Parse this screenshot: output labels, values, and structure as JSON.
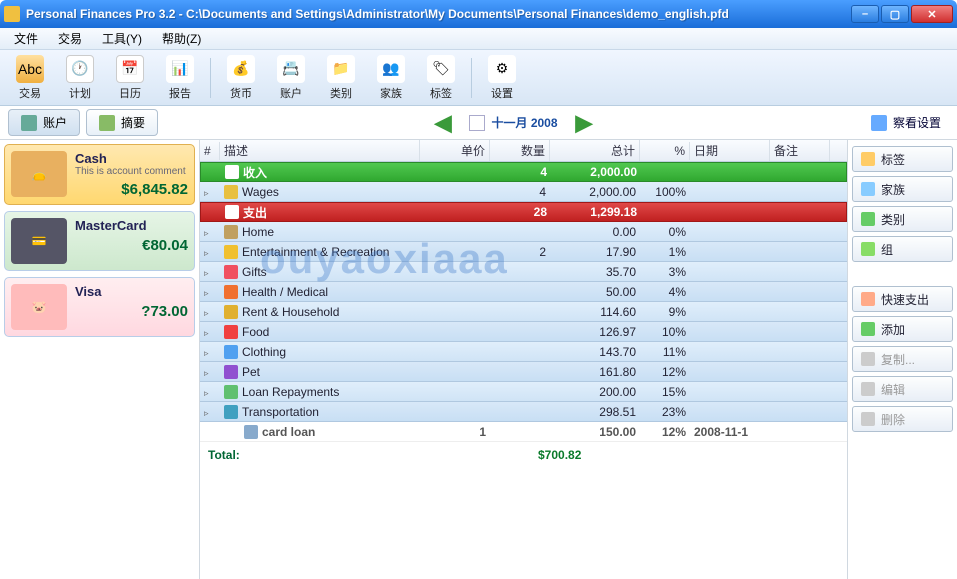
{
  "window": {
    "title": "Personal Finances Pro 3.2 - C:\\Documents and Settings\\Administrator\\My Documents\\Personal Finances\\demo_english.pfd"
  },
  "menu": {
    "file": "文件",
    "trans": "交易",
    "tools": "工具(Y)",
    "help": "帮助(Z)"
  },
  "toolbar": {
    "trans": "交易",
    "plan": "计划",
    "calendar": "日历",
    "report": "报告",
    "currency": "货币",
    "accounts": "账户",
    "categories": "类别",
    "family": "家族",
    "tags": "标签",
    "settings": "设置"
  },
  "subbar": {
    "accounts_tab": "账户",
    "summary_tab": "摘要",
    "month": "十一月 2008",
    "view_settings": "察看设置"
  },
  "accounts": [
    {
      "name": "Cash",
      "comment": "This is account comment",
      "balance": "$6,845.82",
      "icon": "👝",
      "bg": "#e8b060"
    },
    {
      "name": "MasterCard",
      "comment": "",
      "balance": "€80.04",
      "icon": "💳",
      "bg": "#888"
    },
    {
      "name": "Visa",
      "comment": "",
      "balance": "?73.00",
      "icon": "🐷",
      "bg": "#f6a"
    }
  ],
  "grid": {
    "headers": {
      "num": "#",
      "desc": "描述",
      "price": "单价",
      "qty": "数量",
      "total": "总计",
      "pct": "%",
      "date": "日期",
      "note": "备注"
    },
    "income": {
      "label": "收入",
      "qty": "4",
      "total": "2,000.00"
    },
    "income_rows": [
      {
        "desc": "Wages",
        "qty": "4",
        "total": "2,000.00",
        "pct": "100%",
        "color": "#e8c040"
      }
    ],
    "expense": {
      "label": "支出",
      "qty": "28",
      "total": "1,299.18"
    },
    "expense_rows": [
      {
        "desc": "Home",
        "total": "0.00",
        "pct": "0%",
        "color": "#c0a060"
      },
      {
        "desc": "Entertainment & Recreation",
        "qty": "2",
        "total": "17.90",
        "pct": "1%",
        "color": "#f0c030"
      },
      {
        "desc": "Gifts",
        "total": "35.70",
        "pct": "3%",
        "color": "#f05060"
      },
      {
        "desc": "Health / Medical",
        "total": "50.00",
        "pct": "4%",
        "color": "#f07030"
      },
      {
        "desc": "Rent & Household",
        "total": "114.60",
        "pct": "9%",
        "color": "#e0b030"
      },
      {
        "desc": "Food",
        "total": "126.97",
        "pct": "10%",
        "color": "#f04040"
      },
      {
        "desc": "Clothing",
        "total": "143.70",
        "pct": "11%",
        "color": "#50a0f0"
      },
      {
        "desc": "Pet",
        "total": "161.80",
        "pct": "12%",
        "color": "#9050d0"
      },
      {
        "desc": "Loan Repayments",
        "total": "200.00",
        "pct": "15%",
        "color": "#60c070"
      },
      {
        "desc": "Transportation",
        "total": "298.51",
        "pct": "23%",
        "color": "#40a0c0"
      }
    ],
    "leaf": {
      "desc": "card loan",
      "price": "1",
      "total": "150.00",
      "pct": "12%",
      "date": "2008-11-1"
    },
    "total_label": "Total:",
    "total_value": "$700.82"
  },
  "rpanel": {
    "tags": "标签",
    "family": "家族",
    "categories": "类别",
    "group": "组",
    "quick": "快速支出",
    "add": "添加",
    "copy": "复制...",
    "edit": "编辑",
    "delete": "删除"
  },
  "watermark": "ouyaoxiaaa"
}
